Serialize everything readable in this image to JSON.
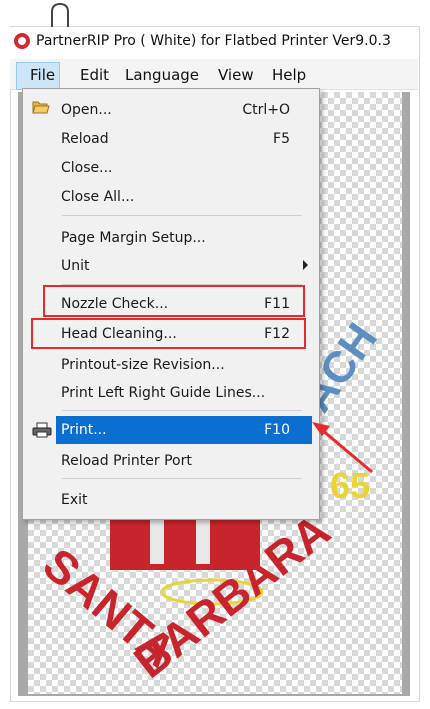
{
  "window": {
    "title": "PartnerRIP Pro ( White) for Flatbed Printer Ver9.0.3"
  },
  "menubar": {
    "items": [
      {
        "label": "File"
      },
      {
        "label": "Edit"
      },
      {
        "label": "Language"
      },
      {
        "label": "View"
      },
      {
        "label": "Help"
      }
    ]
  },
  "file_menu": {
    "items": [
      {
        "label": "Open...",
        "shortcut": "Ctrl+O",
        "icon": "folder-open-icon"
      },
      {
        "label": "Reload",
        "shortcut": "F5"
      },
      {
        "label": "Close...",
        "shortcut": ""
      },
      {
        "label": "Close All...",
        "shortcut": ""
      },
      {
        "label": "Page Margin Setup...",
        "shortcut": ""
      },
      {
        "label": "Unit",
        "shortcut": "",
        "submenu": true
      },
      {
        "label": "Nozzle Check...",
        "shortcut": "F11",
        "highlighted_box": true
      },
      {
        "label": "Head Cleaning...",
        "shortcut": "F12",
        "highlighted_box": true
      },
      {
        "label": "Printout-size Revision...",
        "shortcut": ""
      },
      {
        "label": "Print Left Right Guide Lines...",
        "shortcut": ""
      },
      {
        "label": "Print...",
        "shortcut": "F10",
        "icon": "printer-icon",
        "selected": true
      },
      {
        "label": "Reload Printer Port",
        "shortcut": ""
      },
      {
        "label": "Exit",
        "shortcut": ""
      }
    ]
  },
  "artwork": {
    "text_top": "SANTA",
    "text_bottom": "BARBARA",
    "partial_word": "ACH",
    "partial_number": "65"
  },
  "colors": {
    "selection": "#0a6fd0",
    "annotation": "#e52b2b",
    "art_red": "#c8242c",
    "art_blue": "#5b8fc2",
    "art_yellow": "#e8d434"
  }
}
